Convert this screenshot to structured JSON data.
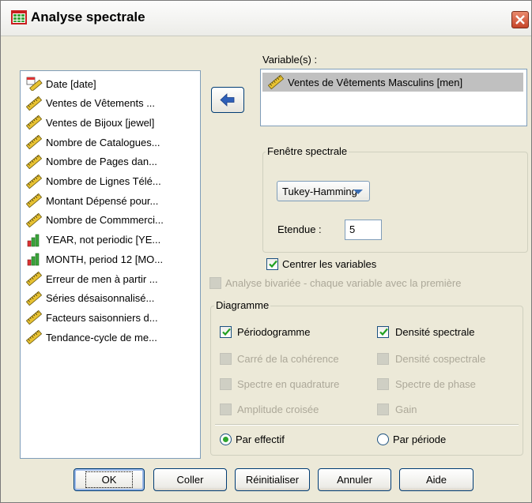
{
  "window": {
    "title": "Analyse spectrale"
  },
  "source_list": {
    "items": [
      {
        "label": "Date [date]",
        "icon": "date-ruler-icon"
      },
      {
        "label": "Ventes de Vêtements ...",
        "icon": "scale-ruler-icon"
      },
      {
        "label": "Ventes de Bijoux [jewel]",
        "icon": "scale-ruler-icon"
      },
      {
        "label": "Nombre de Catalogues...",
        "icon": "scale-ruler-icon"
      },
      {
        "label": "Nombre de Pages dan...",
        "icon": "scale-ruler-icon"
      },
      {
        "label": "Nombre de Lignes Télé...",
        "icon": "scale-ruler-icon"
      },
      {
        "label": "Montant Dépensé pour...",
        "icon": "scale-ruler-icon"
      },
      {
        "label": "Nombre de Commmerci...",
        "icon": "scale-ruler-icon"
      },
      {
        "label": "YEAR, not periodic [YE...",
        "icon": "ordinal-bars-icon"
      },
      {
        "label": "MONTH, period 12 [MO...",
        "icon": "ordinal-bars-icon"
      },
      {
        "label": "Erreur de men à partir ...",
        "icon": "scale-ruler-icon"
      },
      {
        "label": "Séries désaisonnalisé...",
        "icon": "scale-ruler-icon"
      },
      {
        "label": "Facteurs saisonniers d...",
        "icon": "scale-ruler-icon"
      },
      {
        "label": "Tendance-cycle de me...",
        "icon": "scale-ruler-icon"
      }
    ]
  },
  "variables": {
    "label": "Variable(s) :",
    "items": [
      {
        "label": "Ventes de Vêtements Masculins [men]",
        "icon": "scale-ruler-icon"
      }
    ]
  },
  "spectral_window": {
    "title": "Fenêtre spectrale",
    "selected": "Tukey-Hamming",
    "span_label": "Etendue :",
    "span_value": "5"
  },
  "center_variables": {
    "label": "Centrer les variables",
    "checked": true
  },
  "bivariate": {
    "label": "Analyse bivariée - chaque variable avec la première",
    "checked": false,
    "enabled": false
  },
  "plot": {
    "title": "Diagramme",
    "periodogram": {
      "label": "Périodogramme",
      "checked": true
    },
    "spectral_density": {
      "label": "Densité spectrale",
      "checked": true
    },
    "coherence": {
      "label": "Carré de la cohérence",
      "enabled": false
    },
    "cospectral": {
      "label": "Densité cospectrale",
      "enabled": false
    },
    "quadrature": {
      "label": "Spectre en quadrature",
      "enabled": false
    },
    "phase": {
      "label": "Spectre de phase",
      "enabled": false
    },
    "cross_amplitude": {
      "label": "Amplitude croisée",
      "enabled": false
    },
    "gain": {
      "label": "Gain",
      "enabled": false
    },
    "by_frequency": {
      "label": "Par effectif",
      "selected": true
    },
    "by_period": {
      "label": "Par période",
      "selected": false
    }
  },
  "buttons": {
    "ok": "OK",
    "paste": "Coller",
    "reset": "Réinitialiser",
    "cancel": "Annuler",
    "help": "Aide"
  },
  "colors": {
    "frame": "#ECE9D8",
    "check": "#21a121",
    "accent": "#003c74"
  }
}
